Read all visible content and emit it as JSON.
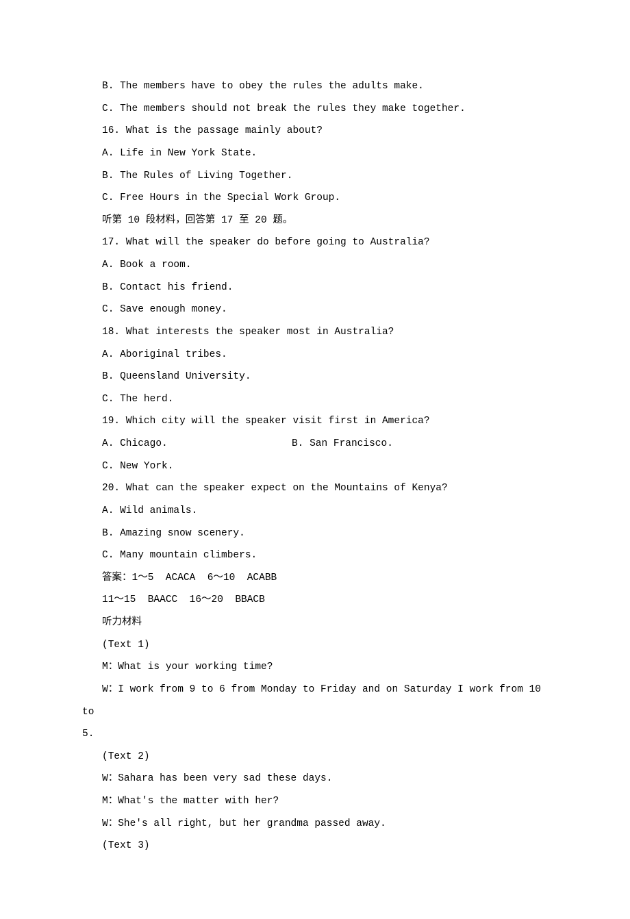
{
  "lines": [
    {
      "text": "B. The members have to obey the rules the adults make."
    },
    {
      "text": "C. The members should not break the rules they make together."
    },
    {
      "text": "16. What is the passage mainly about?"
    },
    {
      "text": "A. Life in New York State."
    },
    {
      "text": "B. The Rules of Living Together."
    },
    {
      "text": "C. Free Hours in the Special Work Group."
    },
    {
      "text": "听第 10 段材料，回答第 17 至 20 题。"
    },
    {
      "text": "17. What will the speaker do before going to Australia?"
    },
    {
      "text": "A. Book a room."
    },
    {
      "text": "B. Contact his friend."
    },
    {
      "text": "C. Save enough money."
    },
    {
      "text": "18. What interests the speaker most in Australia?"
    },
    {
      "text": "A. Aboriginal tribes."
    },
    {
      "text": "B. Queensland University."
    },
    {
      "text": "C. The herd."
    },
    {
      "text": "19. Which city will the speaker visit first in America?"
    },
    {
      "twoCol": true,
      "left": "A. Chicago.",
      "right": "B. San Francisco."
    },
    {
      "text": "C. New York."
    },
    {
      "text": "20. What can the speaker expect on the Mountains of Kenya?"
    },
    {
      "text": "A. Wild animals."
    },
    {
      "text": "B. Amazing snow scenery."
    },
    {
      "text": "C. Many mountain climbers."
    },
    {
      "text": "答案：1～5  ACACA  6～10  ACABB"
    },
    {
      "text": "11～15  BAACC  16～20  BBACB"
    },
    {
      "text": "听力材料"
    },
    {
      "text": "(Text 1)"
    },
    {
      "text": "M：What is your working time?"
    },
    {
      "text": "W：I work from 9 to 6 from Monday to Friday and on Saturday I work from 10 to"
    },
    {
      "noIndent": true,
      "text": "5."
    },
    {
      "text": "(Text 2)"
    },
    {
      "text": "W：Sahara has been very sad these days."
    },
    {
      "text": "M：What's the matter with her?"
    },
    {
      "text": "W：She's all right, but her grandma passed away."
    },
    {
      "text": "(Text 3)"
    }
  ]
}
